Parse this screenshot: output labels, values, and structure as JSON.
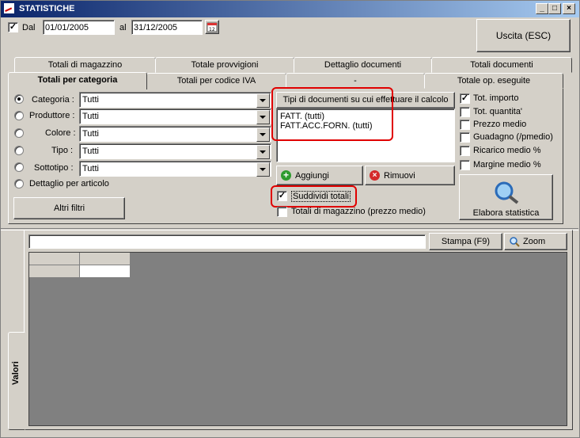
{
  "window": {
    "title": "STATISTICHE",
    "minimize": "_",
    "maximize": "□",
    "close": "×"
  },
  "period": {
    "dal_label": "Dal",
    "from": "01/01/2005",
    "al_label": "al",
    "to": "31/12/2005",
    "enabled": true
  },
  "exit_button": "Uscita (ESC)",
  "tabs_back": [
    "Totali di magazzino",
    "Totale provvigioni",
    "Dettaglio documenti",
    "Totali documenti"
  ],
  "tabs_front": [
    "Totali per categoria",
    "Totali per codice IVA",
    "-",
    "Totale op. eseguite"
  ],
  "filters": [
    {
      "label": "Categoria :",
      "value": "Tutti",
      "selected": true
    },
    {
      "label": "Produttore :",
      "value": "Tutti",
      "selected": false
    },
    {
      "label": "Colore :",
      "value": "Tutti",
      "selected": false
    },
    {
      "label": "Tipo :",
      "value": "Tutti",
      "selected": false
    },
    {
      "label": "Sottotipo :",
      "value": "Tutti",
      "selected": false
    }
  ],
  "detail_article": "Dettaglio per articolo",
  "other_filters_button": "Altri filtri",
  "doc_types": {
    "header": "Tipi di documenti su cui effettuare il calcolo",
    "items": [
      "FATT. (tutti)",
      "FATT.ACC.FORN. (tutti)"
    ]
  },
  "add_button": "Aggiungi",
  "remove_button": "Rimuovi",
  "split_totals": {
    "label": "Suddividi totali",
    "checked": true
  },
  "warehouse_totals": {
    "label": "Totali di magazzino (prezzo medio)",
    "checked": false
  },
  "options": [
    {
      "label": "Tot. importo",
      "checked": true
    },
    {
      "label": "Tot. quantita'",
      "checked": false
    },
    {
      "label": "Prezzo medio",
      "checked": false
    },
    {
      "label": "Guadagno (/pmedio)",
      "checked": false
    },
    {
      "label": "Ricarico medio %",
      "checked": false
    },
    {
      "label": "Margine medio %",
      "checked": false
    }
  ],
  "elaborate_button": "Elabora statistica",
  "results": {
    "side_tab": "Valori",
    "search_value": "",
    "print_button": "Stampa (F9)",
    "zoom_button": "Zoom"
  },
  "colors": {
    "highlight": "#e00000",
    "titlebar": "#0a246a",
    "grid_bg": "#808080",
    "face": "#d4d0c8"
  }
}
